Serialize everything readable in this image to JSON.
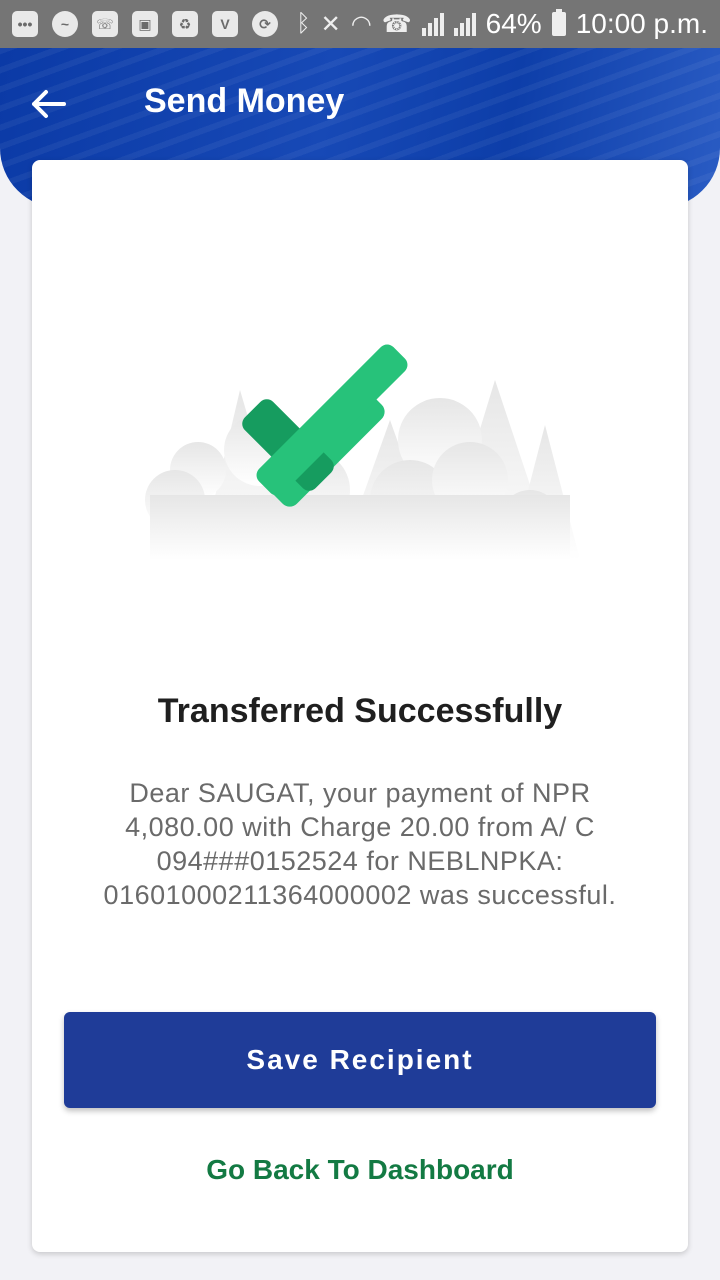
{
  "status_bar": {
    "battery": "64%",
    "time": "10:00 p.m.",
    "icons": [
      "chat-bubble-icon",
      "messenger-icon",
      "phone-icon",
      "image-icon",
      "recycle-icon",
      "v-app-icon",
      "sync-icon",
      "bluetooth-icon",
      "mute-icon",
      "wifi-call-icon",
      "call-icon",
      "signal-icon",
      "signal-icon",
      "battery-icon"
    ]
  },
  "header": {
    "title": "Send Money",
    "back_icon": "arrow-left-icon",
    "color": "#0b3aa6"
  },
  "result": {
    "heading": "Transferred Successfully",
    "message": "Dear SAUGAT, your payment of NPR 4,080.00 with Charge 20.00 from A/ C 094###0152524 for NEBLNPKA: 01601000211364000002 was successful.",
    "icon": "check-mark-icon",
    "check_color": "#27c27a"
  },
  "actions": {
    "save_label": "Save Recipient",
    "dashboard_label": "Go Back To Dashboard",
    "button_color": "#1f3c98",
    "link_color": "#137a43"
  }
}
